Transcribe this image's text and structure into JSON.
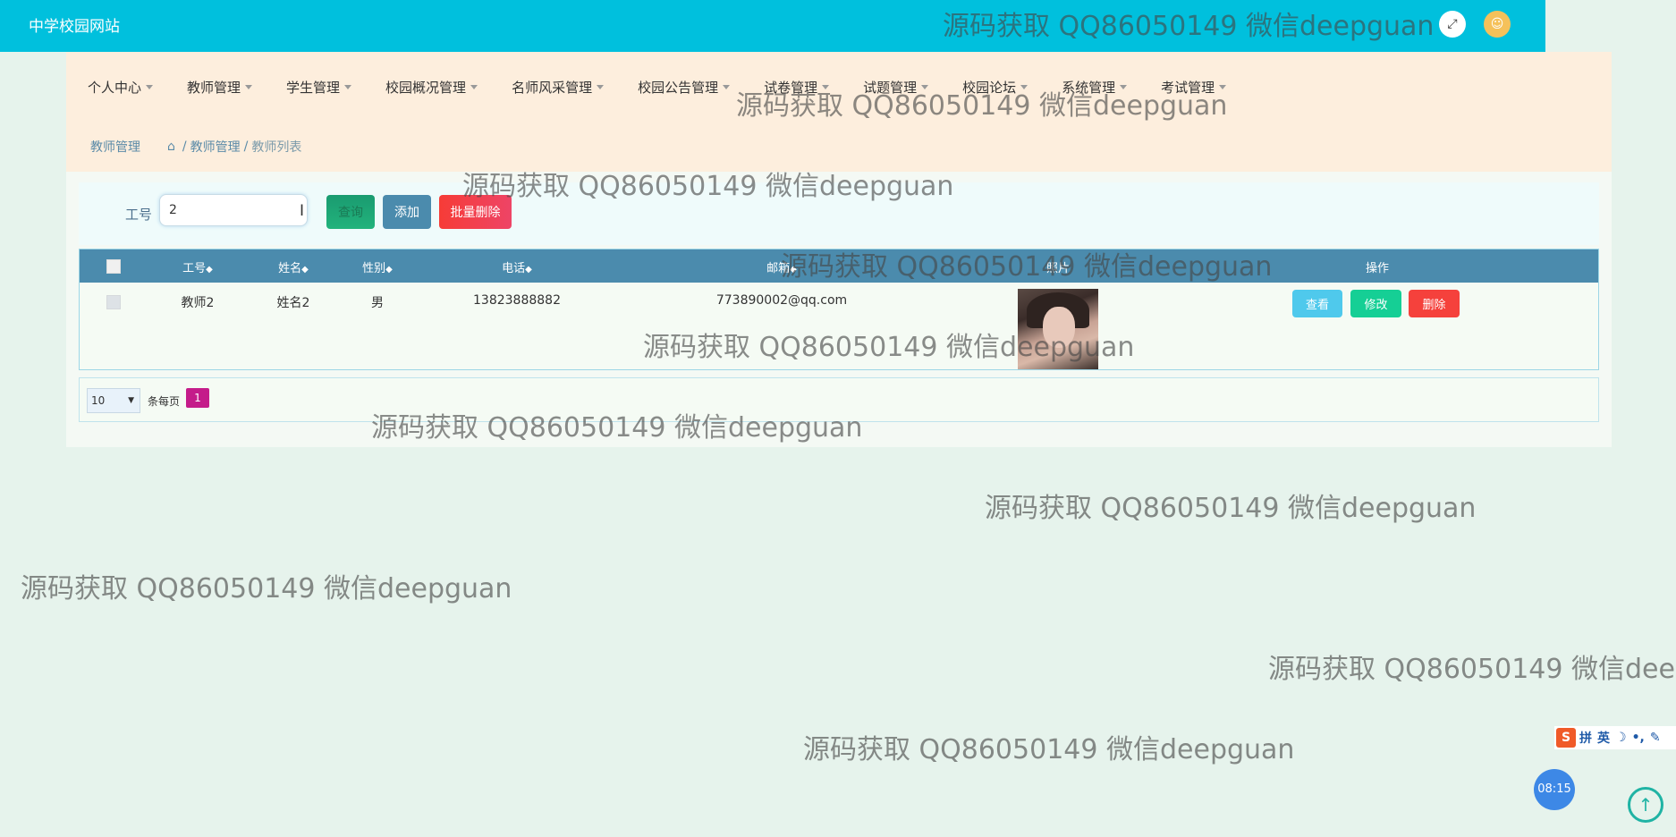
{
  "header": {
    "site_title": "中学校园网站",
    "fullscreen_icon": "expand-icon",
    "user_icon": "user-avatar-icon"
  },
  "nav": {
    "items": [
      {
        "label": "个人中心"
      },
      {
        "label": "教师管理"
      },
      {
        "label": "学生管理"
      },
      {
        "label": "校园概况管理"
      },
      {
        "label": "名师风采管理"
      },
      {
        "label": "校园公告管理"
      },
      {
        "label": "试卷管理"
      },
      {
        "label": "试题管理"
      },
      {
        "label": "校园论坛"
      },
      {
        "label": "系统管理"
      },
      {
        "label": "考试管理"
      }
    ]
  },
  "breadcrumb": {
    "title": "教师管理",
    "sep": "/",
    "path": [
      "教师管理",
      "教师列表"
    ]
  },
  "search": {
    "label": "工号",
    "value": "2",
    "search_button": "查询",
    "add_button": "添加",
    "batch_delete_button": "批量删除"
  },
  "table": {
    "columns": [
      "工号",
      "姓名",
      "性别",
      "电话",
      "邮箱",
      "照片",
      "操作"
    ],
    "sort_glyph": "◆",
    "rows": [
      {
        "id": "教师2",
        "name": "姓名2",
        "gender": "男",
        "phone": "13823888882",
        "email": "773890002@qq.com",
        "actions": [
          "查看",
          "修改",
          "删除"
        ]
      }
    ]
  },
  "pager": {
    "page_size": "10",
    "per_page_label": "条每页",
    "current_page": "1"
  },
  "watermark": {
    "text": "源码获取 QQ86050149 微信deepguan"
  },
  "ime": {
    "logo": "S",
    "labels": [
      "拼",
      "英",
      "☽",
      "•,",
      "✎"
    ]
  },
  "clock": "08:15",
  "colors": {
    "header": "#00c0dd",
    "nav_bg": "#fdeedd",
    "table_head": "#4b8bad",
    "btn_add": "#4b8bad",
    "btn_delete": "#f5413c",
    "btn_view": "#4fc9ec",
    "btn_edit": "#15cf95",
    "page_active": "#c41c8a"
  }
}
